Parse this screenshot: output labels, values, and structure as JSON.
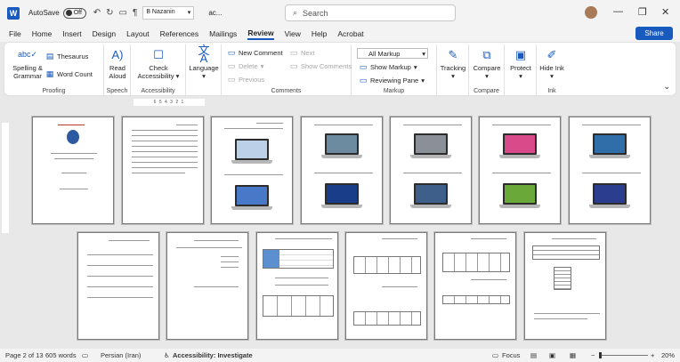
{
  "titlebar": {
    "autosave_label": "AutoSave",
    "autosave_state": "Off",
    "font_name": "B Nazanin",
    "doc_title": "ac...",
    "search_placeholder": "Search"
  },
  "menu": {
    "tabs": [
      "File",
      "Home",
      "Insert",
      "Design",
      "Layout",
      "References",
      "Mailings",
      "Review",
      "View",
      "Help",
      "Acrobat"
    ],
    "active": "Review",
    "share_label": "Share"
  },
  "ribbon": {
    "proofing": {
      "spelling": "Spelling & Grammar",
      "thesaurus": "Thesaurus",
      "word_count": "Word Count",
      "label": "Proofing"
    },
    "speech": {
      "read_aloud": "Read Aloud",
      "label": "Speech"
    },
    "accessibility": {
      "check": "Check Accessibility",
      "label": "Accessibility"
    },
    "language": {
      "button": "Language"
    },
    "comments": {
      "new": "New Comment",
      "delete": "Delete",
      "previous": "Previous",
      "next": "Next",
      "show": "Show Comments",
      "label": "Comments"
    },
    "markup": {
      "all_markup": "All Markup",
      "show_markup": "Show Markup",
      "reviewing_pane": "Reviewing Pane",
      "label": "Markup"
    },
    "tracking": {
      "button": "Tracking"
    },
    "compare": {
      "button": "Compare",
      "label": "Compare"
    },
    "protect": {
      "button": "Protect"
    },
    "ink": {
      "hide_ink": "Hide Ink",
      "label": "Ink"
    }
  },
  "ruler": {
    "marks": "6 5 4 3 2 1"
  },
  "statusbar": {
    "page": "Page 2 of 13",
    "words": "605 words",
    "language": "Persian (Iran)",
    "accessibility": "Accessibility: Investigate",
    "focus": "Focus",
    "zoom": "20%"
  }
}
